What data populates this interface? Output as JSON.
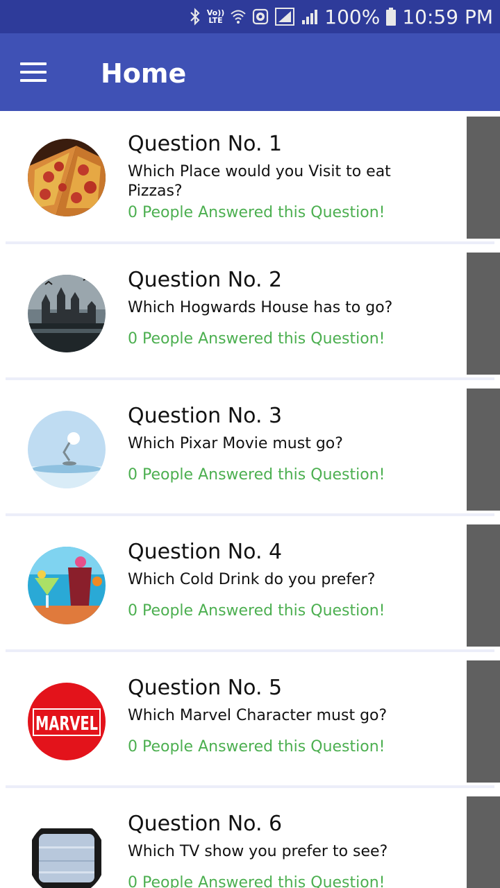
{
  "status_bar": {
    "volte_top": "Vo))",
    "volte_bottom": "LTE",
    "battery": "100%",
    "time": "10:59 PM",
    "icons": [
      "bluetooth-icon",
      "volte-icon",
      "wifi-icon",
      "data-saver-icon",
      "signal-icon",
      "signal-icon-2",
      "battery-icon"
    ]
  },
  "app_bar": {
    "title": "Home",
    "menu_icon": "hamburger-menu-icon",
    "color": "#3f51b5"
  },
  "questions": [
    {
      "title": "Question No. 1",
      "text": "Which Place would you Visit to eat Pizzas?",
      "count": "0 People Answered this Question!",
      "image": "pizza"
    },
    {
      "title": "Question No. 2",
      "text": "Which Hogwards House has to go?",
      "count": "0 People Answered this Question!",
      "image": "hogwarts-castle"
    },
    {
      "title": "Question No. 3",
      "text": "Which Pixar Movie must go?",
      "count": "0 People Answered this Question!",
      "image": "pixar-lamp"
    },
    {
      "title": "Question No. 4",
      "text": "Which Cold Drink do you prefer?",
      "count": "0 People Answered this Question!",
      "image": "cold-drinks"
    },
    {
      "title": "Question No. 5",
      "text": "Which Marvel Character must go?",
      "count": "0 People Answered this Question!",
      "image": "marvel-logo",
      "logo_text": "MARVEL"
    },
    {
      "title": "Question No. 6",
      "text": "Which TV show you prefer to see?",
      "count": "0 People Answered this Question!",
      "image": "tv"
    }
  ],
  "colors": {
    "status_bar": "#2e3b9a",
    "answered_green": "#4caf50",
    "side_strip": "#606060"
  }
}
